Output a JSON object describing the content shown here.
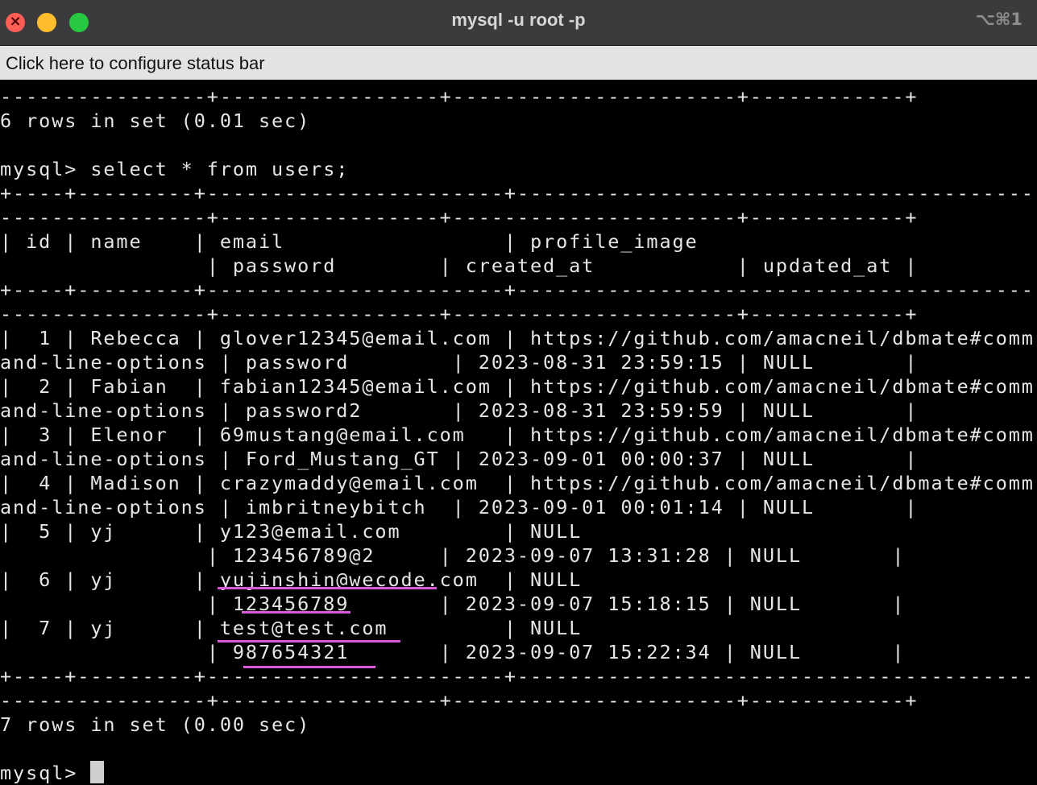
{
  "window": {
    "title": "mysql -u root -p",
    "shortcut": "⌥⌘1"
  },
  "status_bar": {
    "text": "Click here to configure status bar"
  },
  "terminal": {
    "lines": [
      "----------------+-----------------+----------------------+------------+",
      "6 rows in set (0.01 sec)",
      "",
      "mysql> select * from users;",
      "+----+---------+-----------------------+-------------------------------------------",
      "----------------+-----------------+----------------------+------------+",
      "| id | name    | email                 | profile_image",
      "                | password        | created_at           | updated_at |",
      "+----+---------+-----------------------+-------------------------------------------",
      "----------------+-----------------+----------------------+------------+",
      "|  1 | Rebecca | glover12345@email.com | https://github.com/amacneil/dbmate#comm",
      "and-line-options | password        | 2023-08-31 23:59:15 | NULL       |",
      "|  2 | Fabian  | fabian12345@email.com | https://github.com/amacneil/dbmate#comm",
      "and-line-options | password2       | 2023-08-31 23:59:59 | NULL       |",
      "|  3 | Elenor  | 69mustang@email.com   | https://github.com/amacneil/dbmate#comm",
      "and-line-options | Ford_Mustang_GT | 2023-09-01 00:00:37 | NULL       |",
      "|  4 | Madison | crazymaddy@email.com  | https://github.com/amacneil/dbmate#comm",
      "and-line-options | imbritneybitch  | 2023-09-01 00:01:14 | NULL       |",
      "|  5 | yj      | y123@email.com        | NULL",
      "                | 123456789@2     | 2023-09-07 13:31:28 | NULL       |",
      "|  6 | yj      | yujinshin@wecode.com  | NULL",
      "                | 123456789       | 2023-09-07 15:18:15 | NULL       |",
      "|  7 | yj      | test@test.com         | NULL",
      "                | 987654321       | 2023-09-07 15:22:34 | NULL       |",
      "+----+---------+-----------------------+-------------------------------------------",
      "----------------+-----------------+----------------------+------------+",
      "7 rows in set (0.00 sec)",
      "",
      "mysql> "
    ]
  },
  "colors": {
    "annotation": "#d957d9",
    "cursor": "#cfcfcf"
  }
}
